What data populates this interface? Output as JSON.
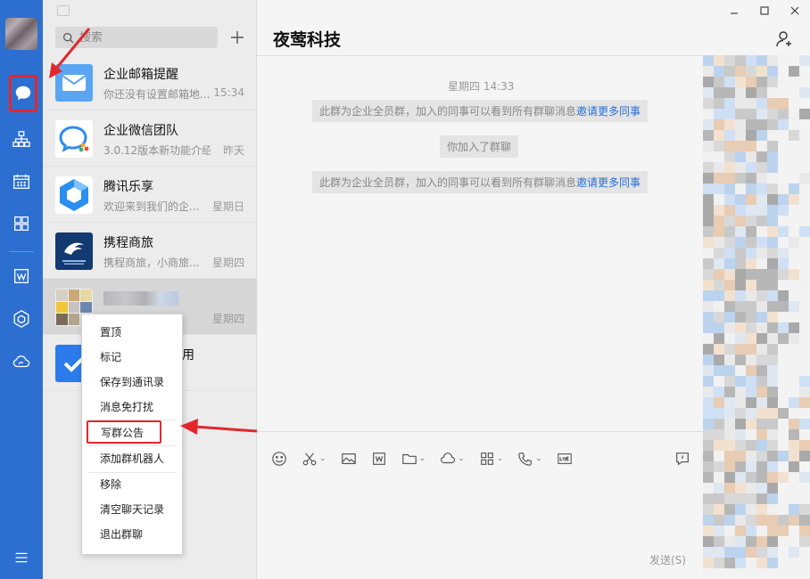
{
  "window": {
    "title": "夜莺科技",
    "buttons": [
      "minimize",
      "maximize",
      "close"
    ]
  },
  "search": {
    "placeholder": "搜索"
  },
  "sessions": [
    {
      "title": "企业邮箱提醒",
      "preview": "你还没有设置邮箱地...",
      "time": "15:34",
      "icon": "mail-icon"
    },
    {
      "title": "企业微信团队",
      "preview": "3.0.12版本新功能介绍",
      "time": "昨天",
      "icon": "wecom-team-icon"
    },
    {
      "title": "腾讯乐享",
      "preview": "欢迎来到我们的企...",
      "time": "星期日",
      "icon": "lexiang-icon"
    },
    {
      "title": "携程商旅",
      "preview": "携程商旅，小商旅...",
      "time": "星期四",
      "icon": "ctrip-icon"
    },
    {
      "title": "",
      "preview": "...",
      "time": "星期四",
      "icon": "group-avatar-icon"
    },
    {
      "title": "用",
      "preview": "",
      "time": "",
      "icon": "approval-icon"
    }
  ],
  "chat": {
    "timestamp": "星期四 14:33",
    "messages": [
      {
        "text": "此群为企业全员群，加入的同事可以看到所有群聊消息",
        "link": "邀请更多同事"
      },
      {
        "text": "你加入了群聊",
        "link": ""
      },
      {
        "text": "此群为企业全员群，加入的同事可以看到所有群聊消息",
        "link": "邀请更多同事"
      }
    ],
    "send_label": "发送(S)"
  },
  "context_menu": {
    "items": [
      "置顶",
      "标记",
      "保存到通讯录",
      "消息免打扰",
      "写群公告",
      "添加群机器人",
      "移除",
      "清空聊天记录",
      "退出群聊"
    ],
    "highlighted": "写群公告"
  },
  "colors": {
    "rail": "#2d6fd0",
    "highlight": "#e1282c",
    "link": "#2a6fd3"
  }
}
